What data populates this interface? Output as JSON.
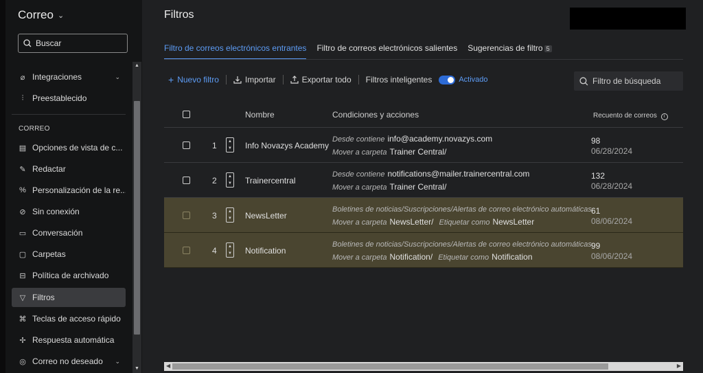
{
  "sidebar": {
    "title": "Correo",
    "search_label": "Buscar",
    "items_top": [
      {
        "label": "Integraciones",
        "icon": "plug-icon"
      },
      {
        "label": "Preestablecido",
        "icon": "sliders-icon"
      }
    ],
    "section_label": "CORREO",
    "items": [
      {
        "label": "Opciones de vista de c...",
        "icon": "layout-icon"
      },
      {
        "label": "Redactar",
        "icon": "compose-icon"
      },
      {
        "label": "Personalización de la re...",
        "icon": "percent-icon"
      },
      {
        "label": "Sin conexión",
        "icon": "offline-icon"
      },
      {
        "label": "Conversación",
        "icon": "chat-icon"
      },
      {
        "label": "Carpetas",
        "icon": "folder-icon"
      },
      {
        "label": "Política de archivado",
        "icon": "archive-icon"
      },
      {
        "label": "Filtros",
        "icon": "filter-icon"
      },
      {
        "label": "Teclas de acceso rápido",
        "icon": "command-icon"
      },
      {
        "label": "Respuesta automática",
        "icon": "auto-reply-icon"
      },
      {
        "label": "Correo no deseado",
        "icon": "shield-icon"
      }
    ],
    "active_item": "Filtros"
  },
  "main": {
    "title": "Filtros",
    "tabs": [
      {
        "label": "Filtro de correos electrónicos entrantes",
        "active": true
      },
      {
        "label": "Filtro de correos electrónicos salientes",
        "active": false
      },
      {
        "label": "Sugerencias de filtro",
        "badge": "5",
        "active": false
      }
    ],
    "toolbar": {
      "new_filter": "Nuevo filtro",
      "import": "Importar",
      "export_all": "Exportar todo",
      "smart_filters": "Filtros inteligentes",
      "toggle_state": "Activado",
      "search_placeholder": "Filtro de búsqueda"
    },
    "table": {
      "headers": {
        "name": "Nombre",
        "conditions": "Condiciones y acciones",
        "count": "Recuento de correos"
      },
      "rows": [
        {
          "num": "1",
          "name": "Info Novazys Academy",
          "c1_label": "Desde contiene",
          "c1_value": "info@academy.novazys.com",
          "c2_label": "Mover a carpeta",
          "c2_value": "Trainer Central/",
          "c3_label": "",
          "c3_value": "",
          "count": "98",
          "date": "06/28/2024",
          "highlight": false
        },
        {
          "num": "2",
          "name": "Trainercentral",
          "c1_label": "Desde contiene",
          "c1_value": "notifications@mailer.trainercentral.com",
          "c2_label": "Mover a carpeta",
          "c2_value": "Trainer Central/",
          "c3_label": "",
          "c3_value": "",
          "count": "132",
          "date": "06/28/2024",
          "highlight": false
        },
        {
          "num": "3",
          "name": "NewsLetter",
          "c1_label": "Boletines de noticias/Suscripciones/Alertas de correo electrónico automáticas.",
          "c1_value": "",
          "c2_label": "Mover a carpeta",
          "c2_value": "NewsLetter/",
          "c3_label": "Etiquetar como",
          "c3_value": "NewsLetter",
          "count": "61",
          "date": "08/06/2024",
          "highlight": true
        },
        {
          "num": "4",
          "name": "Notification",
          "c1_label": "Boletines de noticias/Suscripciones/Alertas de correo electrónico automáticas.",
          "c1_value": "",
          "c2_label": "Mover a carpeta",
          "c2_value": "Notification/",
          "c3_label": "Etiquetar como",
          "c3_value": "Notification",
          "count": "99",
          "date": "08/06/2024",
          "highlight": true
        }
      ]
    }
  },
  "colors": {
    "accent": "#5d9cf5",
    "highlight_row": "#4a4530",
    "toggle_on": "#2d6bd6"
  }
}
